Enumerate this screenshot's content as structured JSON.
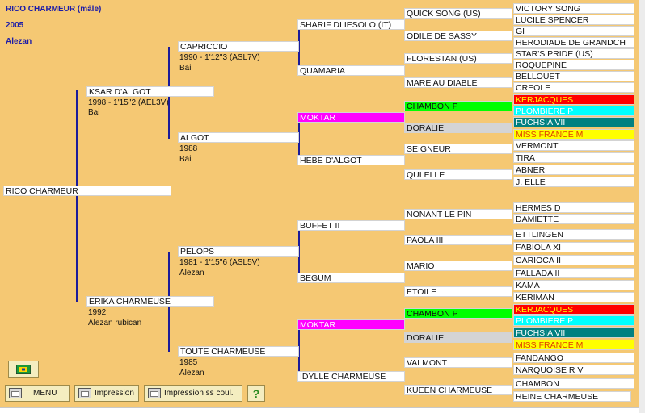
{
  "header": {
    "name": "RICO CHARMEUR  (mâle)",
    "year": "2005",
    "coat": "Alezan"
  },
  "horse": {
    "name": "RICO CHARMEUR"
  },
  "sire": {
    "name": "KSAR D'ALGOT",
    "record": "1998 -  1'15''2 (AEL3V)",
    "coat": "Bai"
  },
  "dam": {
    "name": "ERIKA CHARMEUSE",
    "record": "1992",
    "coat": "Alezan rubican"
  },
  "g2": {
    "ss": {
      "name": "CAPRICCIO",
      "record": "1990 -  1'12''3 (ASL7V)",
      "coat": "Bai"
    },
    "sd": {
      "name": "ALGOT",
      "record": "1988",
      "coat": "Bai"
    },
    "ds": {
      "name": "PELOPS",
      "record": "1981 -  1'15''6 (ASL5V)",
      "coat": "Alezan"
    },
    "dd": {
      "name": "TOUTE CHARMEUSE",
      "record": "1985",
      "coat": "Alezan"
    }
  },
  "g3": [
    "SHARIF DI IESOLO (IT)",
    "QUAMARIA",
    "MOKTAR",
    "HEBE D'ALGOT",
    "BUFFET II",
    "BEGUM",
    "MOKTAR",
    "IDYLLE CHARMEUSE"
  ],
  "g4": [
    "QUICK SONG (US)",
    "ODILE DE SASSY",
    "FLORESTAN (US)",
    "MARE AU DIABLE",
    "CHAMBON P",
    "DORALIE",
    "SEIGNEUR",
    "QUI ELLE",
    "NONANT LE PIN",
    "PAOLA III",
    "MARIO",
    "ETOILE",
    "CHAMBON P",
    "DORALIE",
    "VALMONT",
    "KUEEN CHARMEUSE"
  ],
  "g5": [
    "VICTORY SONG",
    "LUCILE SPENCER",
    "GI",
    "HERODIADE DE GRANDCH",
    "STAR'S PRIDE (US)",
    "ROQUEPINE",
    "BELLOUET",
    "CREOLE",
    "KERJACQUES",
    "PLOMBIERE P",
    "FUCHSIA VII",
    "MISS FRANCE M",
    "VERMONT",
    "TIRA",
    "ABNER",
    "J. ELLE",
    "HERMES D",
    "DAMIETTE",
    "ETTLINGEN",
    "FABIOLA XI",
    "CARIOCA II",
    "FALLADA II",
    "KAMA",
    "KERIMAN",
    "KERJACQUES",
    "PLOMBIERE P",
    "FUCHSIA VII",
    "MISS FRANCE M",
    "FANDANGO",
    "NARQUOISE R V",
    "CHAMBON",
    "REINE CHARMEUSE"
  ],
  "colors": {
    "panel": "#f5c873",
    "line": "#1b1b9a",
    "header_text": "#1c1ca8",
    "moktar": "#ff00ff",
    "chambon": "#00ff00",
    "doralie": "#d4d4d4",
    "kerjacques": "#ff0000",
    "plombiere": "#00ffff",
    "fuchsia": "#008080",
    "miss_france": "#ffff00"
  },
  "buttons": {
    "menu": "MENU",
    "print": "Impression",
    "print_bw": "Impression ss coul.",
    "help": "?",
    "flag_icon": "flag-icon"
  }
}
